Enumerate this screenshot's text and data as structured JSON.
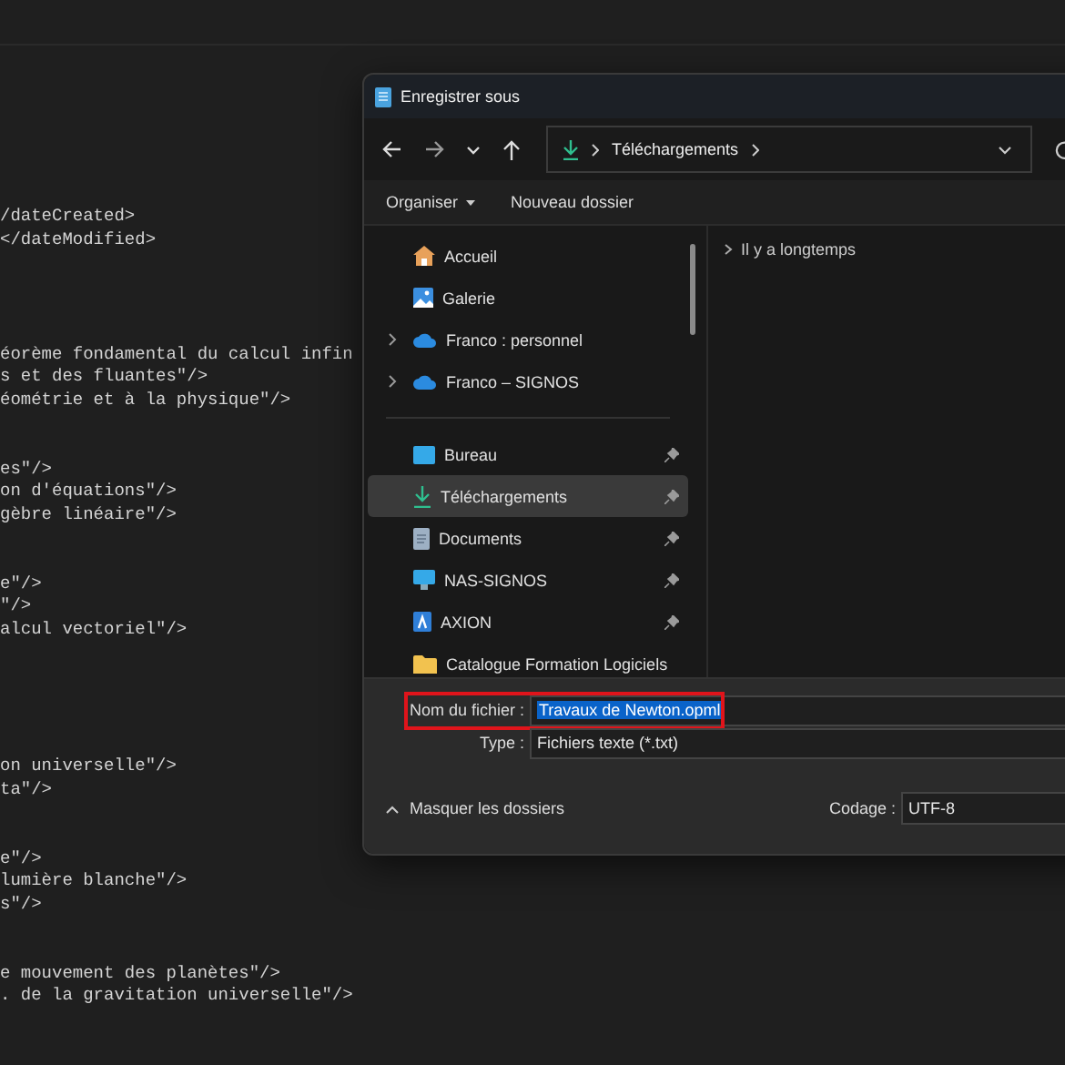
{
  "editor": {
    "blocks": [
      [
        "/dateCreated>",
        "</dateModified>"
      ],
      [
        "éorème fondamental du calcul infin",
        "s et des fluantes\"/>",
        "éométrie et à la physique\"/>"
      ],
      [
        "es\"/>",
        "on d'équations\"/>",
        "gèbre linéaire\"/>"
      ],
      [
        "e\"/>",
        "\"/>",
        "alcul vectoriel\"/>"
      ],
      [
        "on universelle\"/>",
        "ta\"/>"
      ],
      [
        "e\"/>",
        "lumière blanche\"/>",
        "s\"/>"
      ],
      [
        "e mouvement des planètes\"/>",
        ". de la gravitation universelle\"/>"
      ]
    ]
  },
  "dialog": {
    "title": "Enregistrer sous",
    "address": {
      "segments": [
        "Téléchargements"
      ]
    },
    "toolbar": [
      {
        "label": "Organiser",
        "dropdown": true
      },
      {
        "label": "Nouveau dossier",
        "dropdown": false
      }
    ],
    "nav_items": [
      {
        "label": "Accueil",
        "kind": "home",
        "expandable": false,
        "pinned": false,
        "selected": false
      },
      {
        "label": "Galerie",
        "kind": "gallery",
        "expandable": false,
        "pinned": false,
        "selected": false
      },
      {
        "label": "Franco : personnel",
        "kind": "cloud",
        "expandable": true,
        "pinned": false,
        "selected": false
      },
      {
        "label": "Franco – SIGNOS",
        "kind": "cloud",
        "expandable": true,
        "pinned": false,
        "selected": false
      },
      {
        "label": "Bureau",
        "kind": "desktop",
        "expandable": false,
        "pinned": true,
        "selected": false
      },
      {
        "label": "Téléchargements",
        "kind": "download",
        "expandable": false,
        "pinned": true,
        "selected": true
      },
      {
        "label": "Documents",
        "kind": "document",
        "expandable": false,
        "pinned": true,
        "selected": false
      },
      {
        "label": "NAS-SIGNOS",
        "kind": "monitor",
        "expandable": false,
        "pinned": true,
        "selected": false
      },
      {
        "label": "AXION",
        "kind": "app",
        "expandable": false,
        "pinned": true,
        "selected": false
      },
      {
        "label": "Catalogue Formation Logiciels",
        "kind": "folder",
        "expandable": false,
        "pinned": false,
        "selected": false
      }
    ],
    "groups": [
      {
        "label": "Il y a longtemps",
        "expanded": false
      }
    ],
    "file_name": {
      "label": "Nom du fichier :",
      "value": "Travaux de Newton.opml",
      "text_selected": true,
      "highlighted": true
    },
    "file_type": {
      "label": "Type :",
      "value": "Fichiers texte (*.txt)"
    },
    "folders_toggle": {
      "label": "Masquer les dossiers",
      "expanded": true
    },
    "encoding": {
      "label": "Codage :",
      "value": "UTF-8"
    }
  }
}
